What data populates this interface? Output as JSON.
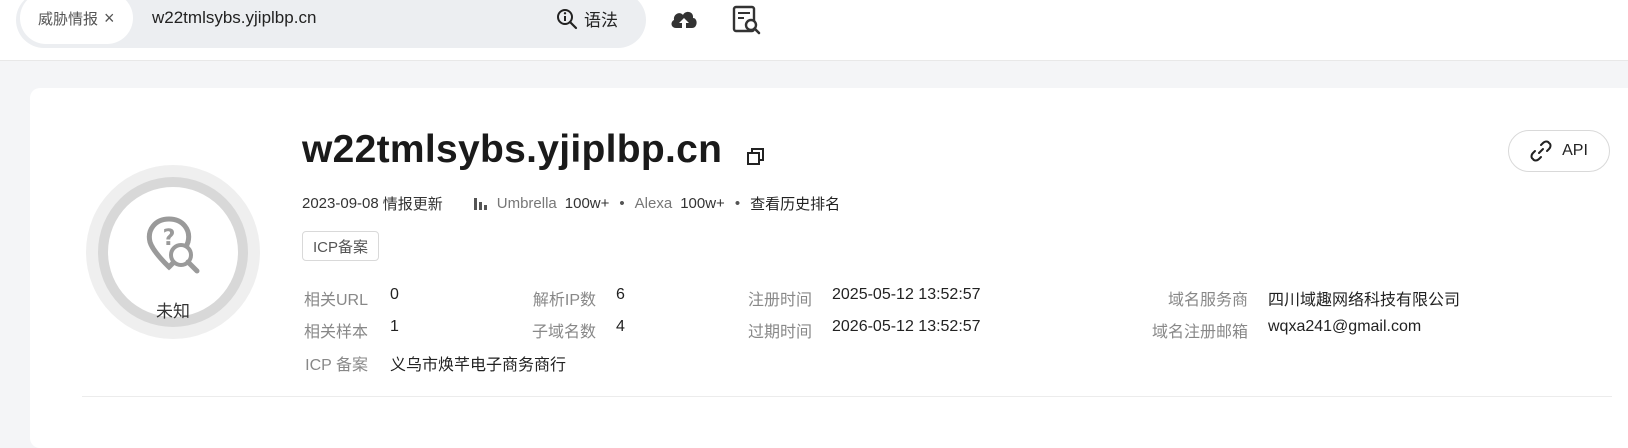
{
  "search": {
    "tag_label": "威胁情报",
    "tag_close": "×",
    "query": "w22tmlsybs.yjiplbp.cn",
    "syntax_label": "语法"
  },
  "toolbar": {
    "upload_icon": "cloud-upload-icon",
    "report_icon": "report-search-icon"
  },
  "result": {
    "domain": "w22tmlsybs.yjiplbp.cn",
    "verdict": "未知",
    "api_label": "API",
    "update_date": "2023-09-08",
    "update_label": "情报更新",
    "umbrella_label": "Umbrella",
    "umbrella_rank": "100w+",
    "alexa_label": "Alexa",
    "alexa_rank": "100w+",
    "history_rank_label": "查看历史排名",
    "icp_pill": "ICP备案"
  },
  "fields": {
    "related_url": {
      "label": "相关URL",
      "value": "0"
    },
    "related_sample": {
      "label": "相关样本",
      "value": "1"
    },
    "icp": {
      "label": "ICP 备案",
      "value": "义乌市焕芊电子商务商行"
    },
    "resolved_ip": {
      "label": "解析IP数",
      "value": "6"
    },
    "subdomains": {
      "label": "子域名数",
      "value": "4"
    },
    "register_time": {
      "label": "注册时间",
      "value": "2025-05-12 13:52:57"
    },
    "expire_time": {
      "label": "过期时间",
      "value": "2026-05-12 13:52:57"
    },
    "registrar": {
      "label": "域名服务商",
      "value": "四川域趣网络科技有限公司"
    },
    "registrant_email": {
      "label": "域名注册邮箱",
      "value": "wqxa241@gmail.com"
    }
  }
}
